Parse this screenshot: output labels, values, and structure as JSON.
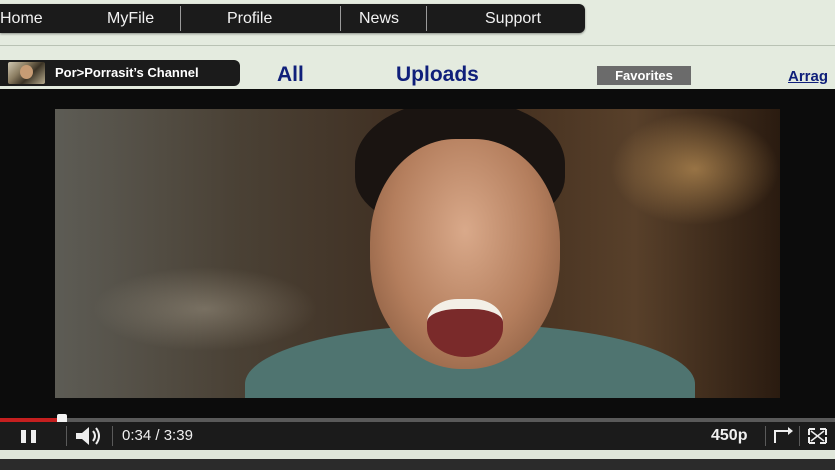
{
  "nav": {
    "items": [
      {
        "label": "Home"
      },
      {
        "label": "MyFile"
      },
      {
        "label": "Profile"
      },
      {
        "label": "News"
      },
      {
        "label": "Support"
      }
    ]
  },
  "channel": {
    "name": "Por>Porrasit’s Channel"
  },
  "tabs": {
    "all": "All",
    "uploads": "Uploads",
    "favorites": "Favorites",
    "arrange": "Arrag"
  },
  "player": {
    "current_time": "0:34",
    "time_separator": "/",
    "duration": "3:39",
    "quality": "450p",
    "progress_fraction": 0.155,
    "progress_color": "#c51f1f"
  }
}
